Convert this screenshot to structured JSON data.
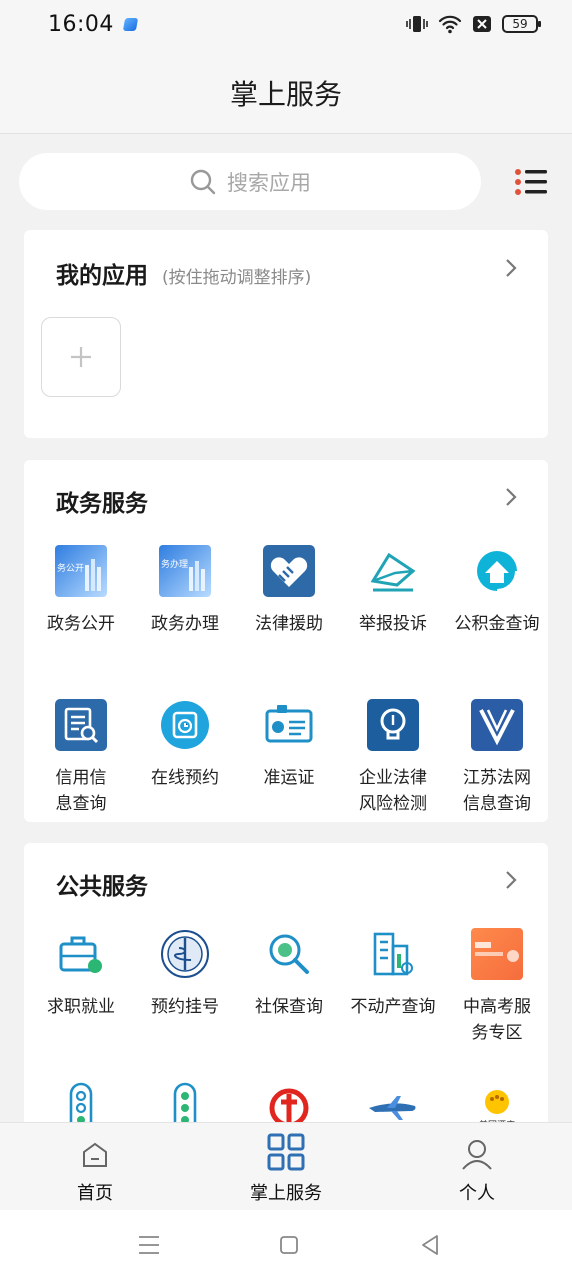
{
  "status_bar": {
    "time": "16:04",
    "battery": "59"
  },
  "header": {
    "title": "掌上服务"
  },
  "search": {
    "placeholder": "搜索应用"
  },
  "my_apps": {
    "title": "我的应用",
    "hint": "(按住拖动调整排序)",
    "add_icon": "plus-icon"
  },
  "gov_services": {
    "title": "政务服务",
    "items": [
      {
        "label": "政务公开",
        "icon": "gov-public-icon"
      },
      {
        "label": "政务办理",
        "icon": "gov-handle-icon"
      },
      {
        "label": "法律援助",
        "icon": "handshake-icon"
      },
      {
        "label": "举报投诉",
        "icon": "envelope-icon"
      },
      {
        "label": "公积金查询",
        "icon": "house-fund-icon"
      },
      {
        "label": "信用信息查询",
        "icon": "credit-search-icon"
      },
      {
        "label": "在线预约",
        "icon": "clock-calendar-icon"
      },
      {
        "label": "准运证",
        "icon": "id-card-icon"
      },
      {
        "label": "企业法律风险检测",
        "icon": "lightbulb-icon"
      },
      {
        "label": "江苏法网信息查询",
        "icon": "v-logo-icon"
      }
    ]
  },
  "public_services": {
    "title": "公共服务",
    "items": [
      {
        "label": "求职就业",
        "icon": "briefcase-icon"
      },
      {
        "label": "预约挂号",
        "icon": "who-emblem-icon"
      },
      {
        "label": "社保查询",
        "icon": "social-security-search-icon"
      },
      {
        "label": "不动产查询",
        "icon": "building-icon"
      },
      {
        "label": "中高考服务专区",
        "icon": "exam-banner-icon"
      },
      {
        "label": "",
        "icon": "traffic-light-icon"
      },
      {
        "label": "",
        "icon": "traffic-light-icon"
      },
      {
        "label": "",
        "icon": "railway-logo-icon"
      },
      {
        "label": "",
        "icon": "airplane-icon"
      },
      {
        "label": "美团酒店",
        "icon": "meituan-hotel-icon"
      }
    ]
  },
  "tabbar": {
    "items": [
      {
        "label": "首页",
        "icon": "home-icon"
      },
      {
        "label": "掌上服务",
        "icon": "grid-icon"
      },
      {
        "label": "个人",
        "icon": "person-icon"
      }
    ]
  },
  "colors": {
    "primary_blue": "#2f6fb3",
    "icon_teal": "#21a3c7",
    "text": "#222222",
    "hint": "#8a8a8a"
  }
}
